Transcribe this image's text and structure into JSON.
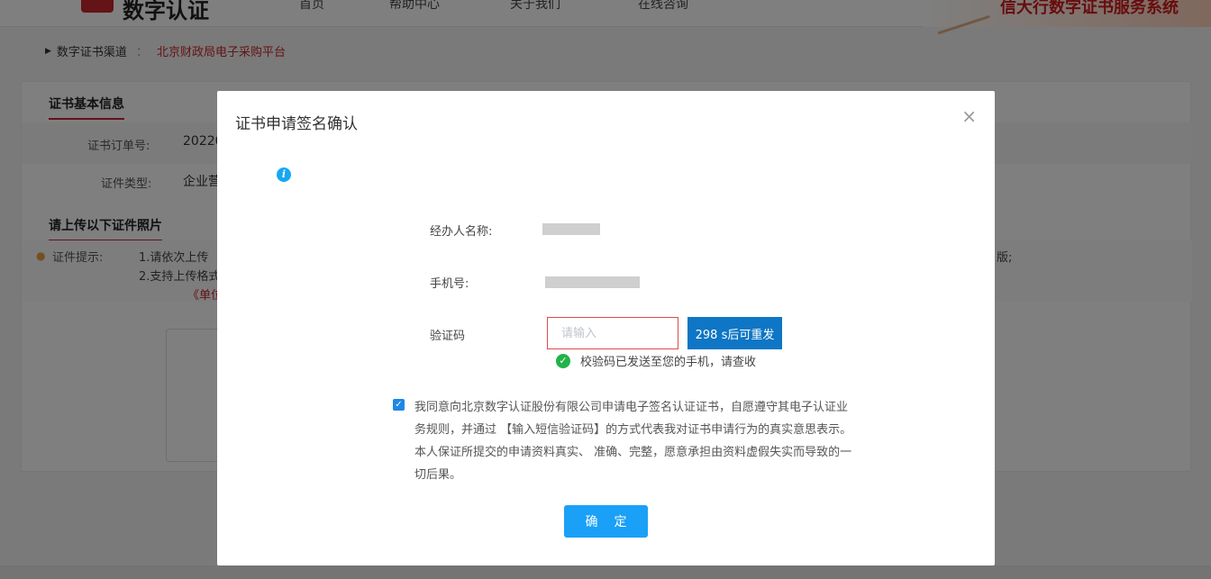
{
  "header": {
    "logo_text": "数字认证",
    "nav": [
      "首页",
      "帮助中心",
      "关于我们",
      "在线咨询"
    ],
    "banner_text": "信大行数字证书服务系统"
  },
  "breadcrumb": {
    "channel_label": "数字证书渠道",
    "separator": "：",
    "platform": "北京财政局电子采购平台"
  },
  "background_form": {
    "section1_title": "证书基本信息",
    "order_label": "证书订单号:",
    "order_value_partial": "20220",
    "cert_type_label": "证件类型:",
    "cert_type_partial": "企业营",
    "section2_title": "请上传以下证件照片",
    "tip_label": "证件提示:",
    "tip_line1_partial": "1.请依次上传",
    "tip_line2_partial": "2.支持上传格式",
    "tip_line3_partial": "《单位",
    "tip_right_fragment": "版;"
  },
  "modal": {
    "title": "证书申请签名确认",
    "close_symbol": "×",
    "agent_label": "经办人名称:",
    "phone_label": "手机号:",
    "code_label": "验证码",
    "code_placeholder": "请输入",
    "code_value": "",
    "resend_label": "298 s后可重发",
    "sent_message": "校验码已发送至您的手机，请查收",
    "agreement_text": "我同意向北京数字认证股份有限公司申请电子签名认证证书，自愿遵守其电子认证业务规则，并通过 【输入短信验证码】的方式代表我对证书申请行为的真实意思表示。本人保证所提交的申请资料真实、 准确、完整，愿意承担由资料虚假失实而导致的一切后果。",
    "agree_checked": true,
    "confirm_label": "确定"
  },
  "colors": {
    "brand_red": "#c9272c",
    "resend_blue": "#0e76c5",
    "confirm_blue": "#1aa0f7",
    "success_green": "#21b34a",
    "input_error_border": "#e14a4a"
  }
}
